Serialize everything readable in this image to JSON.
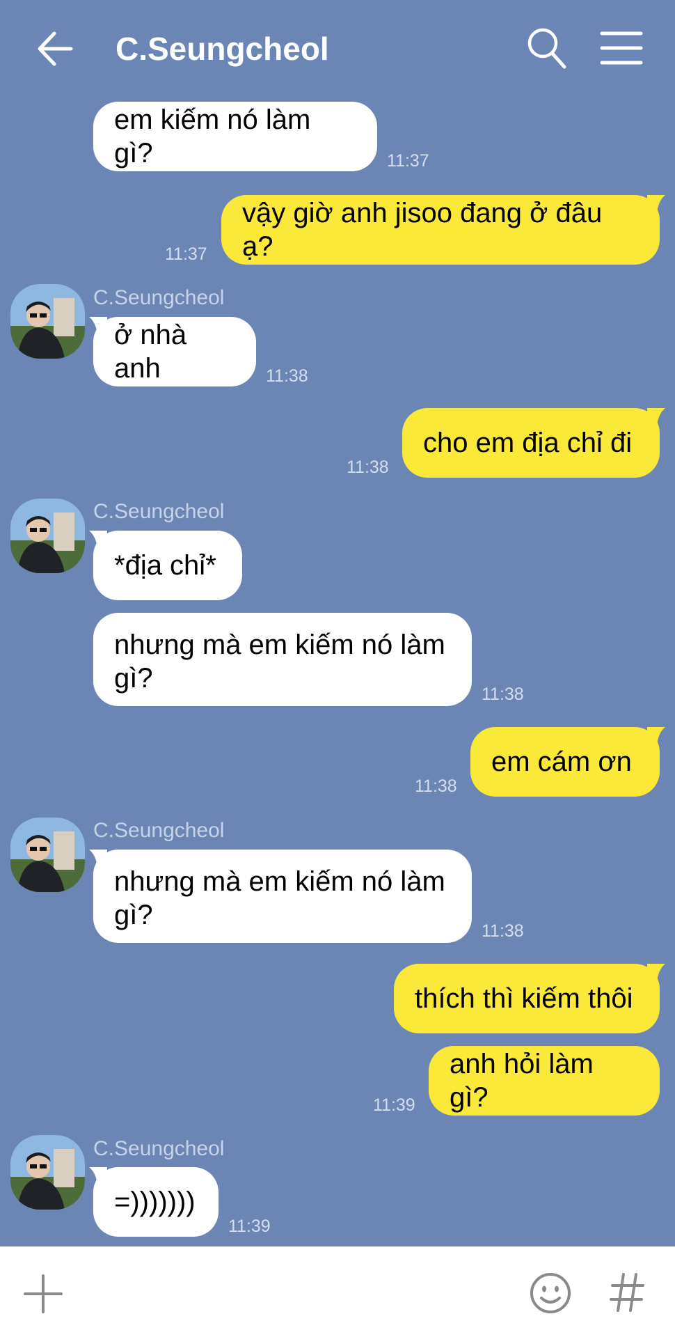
{
  "header": {
    "title": "C.Seungcheol",
    "back_icon": "arrow-left-icon",
    "search_icon": "search-icon",
    "menu_icon": "hamburger-menu-icon"
  },
  "colors": {
    "background": "#6B86B4",
    "incoming_bubble": "#FFFFFF",
    "outgoing_bubble": "#FBE93A",
    "time_text": "#D5DEEE"
  },
  "messages": [
    {
      "direction": "in",
      "text": "em kiếm nó làm gì?",
      "time": "11:37"
    },
    {
      "direction": "out",
      "text": "vậy giờ anh jisoo đang ở đâu ạ?",
      "time": "11:37"
    },
    {
      "direction": "in",
      "sender": "C.Seungcheol",
      "text": "ở nhà anh",
      "time": "11:38"
    },
    {
      "direction": "out",
      "text": "cho em địa chỉ đi",
      "time": "11:38"
    },
    {
      "direction": "in",
      "sender": "C.Seungcheol",
      "text": "*địa chỉ*"
    },
    {
      "direction": "in",
      "text": "nhưng mà em kiếm nó làm gì?",
      "time": "11:38"
    },
    {
      "direction": "out",
      "text": "em cám ơn",
      "time": "11:38"
    },
    {
      "direction": "in",
      "sender": "C.Seungcheol",
      "text": "nhưng mà em kiếm nó làm gì?",
      "time": "11:38"
    },
    {
      "direction": "out",
      "text": "thích thì kiếm thôi"
    },
    {
      "direction": "out",
      "text": "anh hỏi làm gì?",
      "time": "11:39"
    },
    {
      "direction": "in",
      "sender": "C.Seungcheol",
      "text": "=)))))))",
      "time": "11:39"
    }
  ],
  "footer": {
    "plus_icon": "plus-icon",
    "emoji_icon": "emoji-icon",
    "hash_icon": "hashtag-icon"
  }
}
